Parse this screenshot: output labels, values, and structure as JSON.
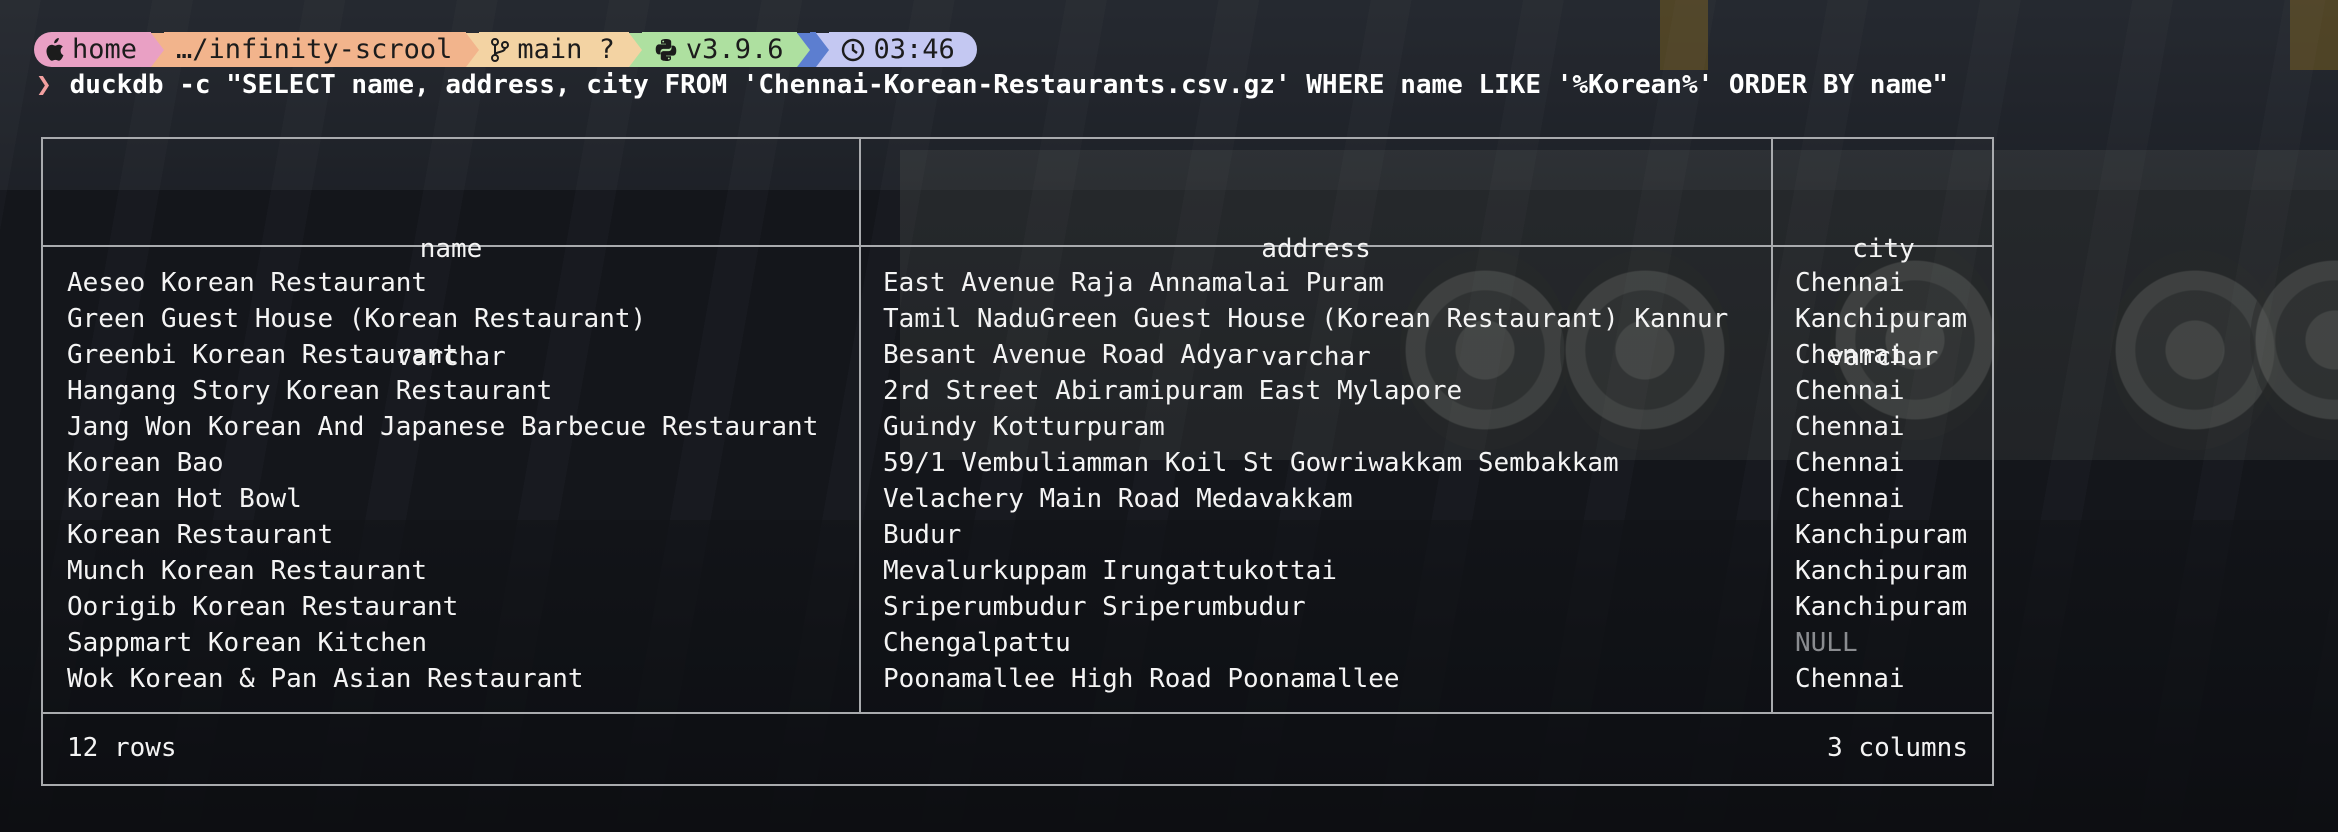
{
  "prompt": {
    "home": "home",
    "path": "…/infinity-scrool",
    "branch": "main ?",
    "python": "v3.9.6",
    "time": "03:46"
  },
  "command": "duckdb -c \"SELECT name, address, city FROM 'Chennai-Korean-Restaurants.csv.gz' WHERE name LIKE '%Korean%' ORDER BY name\"",
  "table": {
    "columns": [
      {
        "name": "name",
        "type": "varchar"
      },
      {
        "name": "address",
        "type": "varchar"
      },
      {
        "name": "city",
        "type": "varchar"
      }
    ],
    "rows": [
      [
        "Aeseo Korean Restaurant",
        "East Avenue Raja Annamalai Puram",
        "Chennai"
      ],
      [
        "Green Guest House (Korean Restaurant)",
        "Tamil NaduGreen Guest House (Korean Restaurant) Kannur",
        "Kanchipuram"
      ],
      [
        "Greenbi Korean Restaurant",
        "Besant Avenue Road Adyar",
        "Chennai"
      ],
      [
        "Hangang Story Korean Restaurant",
        "2rd Street Abiramipuram East Mylapore",
        "Chennai"
      ],
      [
        "Jang Won Korean And Japanese Barbecue Restaurant",
        "Guindy Kotturpuram",
        "Chennai"
      ],
      [
        "Korean Bao",
        "59/1 Vembuliamman Koil St Gowriwakkam Sembakkam",
        "Chennai"
      ],
      [
        "Korean Hot Bowl",
        "Velachery Main Road Medavakkam",
        "Chennai"
      ],
      [
        "Korean Restaurant",
        "Budur",
        "Kanchipuram"
      ],
      [
        "Munch Korean Restaurant",
        "Mevalurkuppam Irungattukottai",
        "Kanchipuram"
      ],
      [
        "Oorigib Korean Restaurant",
        "Sriperumbudur Sriperumbudur",
        "Kanchipuram"
      ],
      [
        "Sappmart Korean Kitchen",
        "Chengalpattu",
        "NULL"
      ],
      [
        "Wok Korean & Pan Asian Restaurant",
        "Poonamallee High Road Poonamallee",
        "Chennai"
      ]
    ],
    "row_count": "12 rows",
    "column_count": "3 columns"
  },
  "colors": {
    "seg_home": "#e9a0c4",
    "seg_path": "#f2b48c",
    "seg_git": "#f3d3a3",
    "seg_python": "#aee0a0",
    "seg_time": "#c4c8f2",
    "null_text": "#8a8c90"
  },
  "icons": [
    "apple-icon",
    "git-branch-icon",
    "python-icon",
    "clock-icon",
    "chevron-right-icon"
  ]
}
